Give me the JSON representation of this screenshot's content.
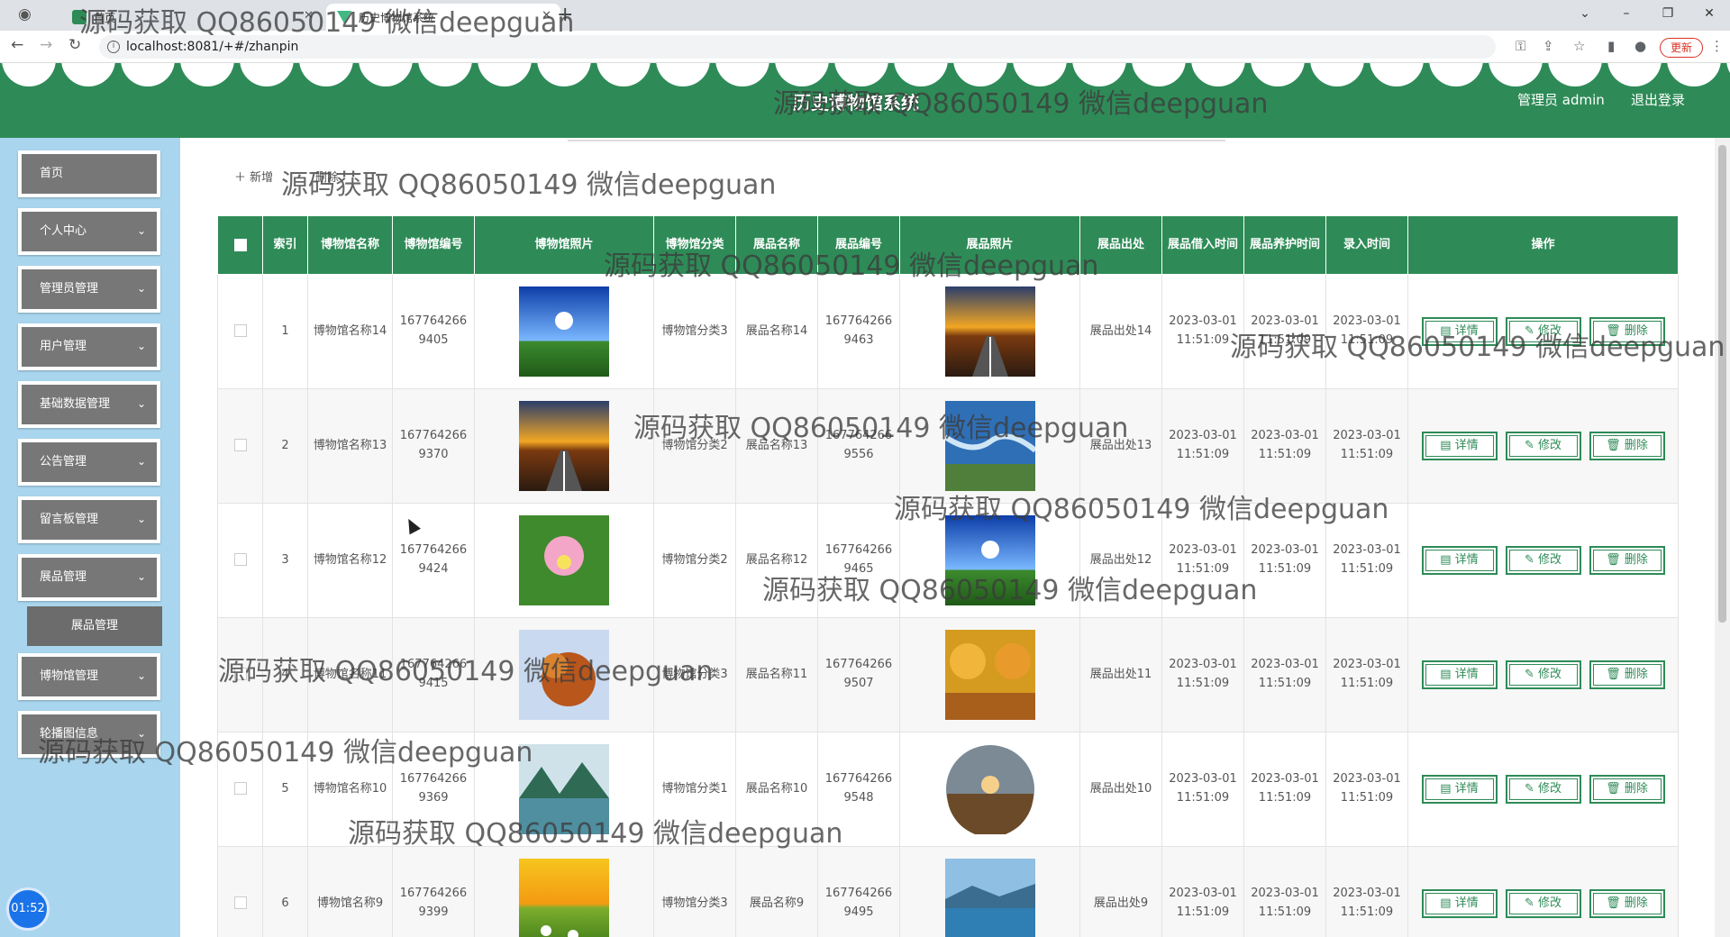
{
  "browser": {
    "tabs": [
      {
        "label": "首页"
      },
      {
        "label": "历史博物馆系统"
      }
    ],
    "url": "localhost:8081/+#/zhanpin",
    "update_label": "更新"
  },
  "header": {
    "title": "历史博物馆系统",
    "user": "管理员 admin",
    "logout": "退出登录"
  },
  "sidebar": {
    "items": [
      {
        "label": "首页",
        "has_arrow": false
      },
      {
        "label": "个人中心",
        "has_arrow": true
      },
      {
        "label": "管理员管理",
        "has_arrow": true
      },
      {
        "label": "用户管理",
        "has_arrow": true
      },
      {
        "label": "基础数据管理",
        "has_arrow": true
      },
      {
        "label": "公告管理",
        "has_arrow": true
      },
      {
        "label": "留言板管理",
        "has_arrow": true
      },
      {
        "label": "展品管理",
        "has_arrow": true
      },
      {
        "label": "博物馆管理",
        "has_arrow": true
      },
      {
        "label": "轮播图信息",
        "has_arrow": true
      }
    ],
    "submenu": "展品管理",
    "clock": "01:52"
  },
  "toolbar": {
    "add": "＋ 新增",
    "delete": "删除"
  },
  "table": {
    "headers": [
      "索引",
      "博物馆名称",
      "博物馆编号",
      "博物馆照片",
      "博物馆分类",
      "展品名称",
      "展品编号",
      "展品照片",
      "展品出处",
      "展品借入时间",
      "展品养护时间",
      "录入时间",
      "操作"
    ],
    "actions": {
      "detail": "详情",
      "edit": "修改",
      "delete": "删除"
    },
    "rows": [
      {
        "index": "1",
        "museum_name": "博物馆名称14",
        "museum_no": "1677642669405",
        "museum_photo": "sky-meadow",
        "museum_cat": "博物馆分类3",
        "item_name": "展品名称14",
        "item_no": "1677642669463",
        "item_photo": "sunset-road",
        "origin": "展品出处14",
        "borrow_time": "2023-03-01 11:51:09",
        "care_time": "2023-03-01 11:51:09",
        "entry_time": "2023-03-01 11:51:09"
      },
      {
        "index": "2",
        "museum_name": "博物馆名称13",
        "museum_no": "1677642669370",
        "museum_photo": "sunset-road",
        "museum_cat": "博物馆分类2",
        "item_name": "展品名称13",
        "item_no": "1677642669556",
        "item_photo": "river-aerial",
        "origin": "展品出处13",
        "borrow_time": "2023-03-01 11:51:09",
        "care_time": "2023-03-01 11:51:09",
        "entry_time": "2023-03-01 11:51:09"
      },
      {
        "index": "3",
        "museum_name": "博物馆名称12",
        "museum_no": "1677642669424",
        "museum_photo": "lotus",
        "museum_cat": "博物馆分类2",
        "item_name": "展品名称12",
        "item_no": "1677642669465",
        "item_photo": "sky-meadow",
        "origin": "展品出处12",
        "borrow_time": "2023-03-01 11:51:09",
        "care_time": "2023-03-01 11:51:09",
        "entry_time": "2023-03-01 11:51:09"
      },
      {
        "index": "4",
        "museum_name": "博物馆名称11",
        "museum_no": "1677642669415",
        "museum_photo": "autumn-leaves",
        "museum_cat": "博物馆分类3",
        "item_name": "展品名称11",
        "item_no": "1677642669507",
        "item_photo": "autumn-avenue",
        "origin": "展品出处11",
        "borrow_time": "2023-03-01 11:51:09",
        "care_time": "2023-03-01 11:51:09",
        "entry_time": "2023-03-01 11:51:09"
      },
      {
        "index": "5",
        "museum_name": "博物馆名称10",
        "museum_no": "1677642669369",
        "museum_photo": "mountain-lake",
        "museum_cat": "博物馆分类1",
        "item_name": "展品名称10",
        "item_no": "1677642669548",
        "item_photo": "fisheye-sunset",
        "origin": "展品出处10",
        "borrow_time": "2023-03-01 11:51:09",
        "care_time": "2023-03-01 11:51:09",
        "entry_time": "2023-03-01 11:51:09"
      },
      {
        "index": "6",
        "museum_name": "博物馆名称9",
        "museum_no": "1677642669399",
        "museum_photo": "daisy-field",
        "museum_cat": "博物馆分类3",
        "item_name": "展品名称9",
        "item_no": "1677642669495",
        "item_photo": "blue-lake",
        "origin": "展品出处9",
        "borrow_time": "2023-03-01 11:51:09",
        "care_time": "2023-03-01 11:51:09",
        "entry_time": "2023-03-01 11:51:09"
      }
    ]
  },
  "watermark": "源码获取 QQ86050149 微信deepguan",
  "colors": {
    "primary": "#2e8b57",
    "sidebar_bg": "#a9d6ee",
    "menu_bg": "#777777"
  }
}
